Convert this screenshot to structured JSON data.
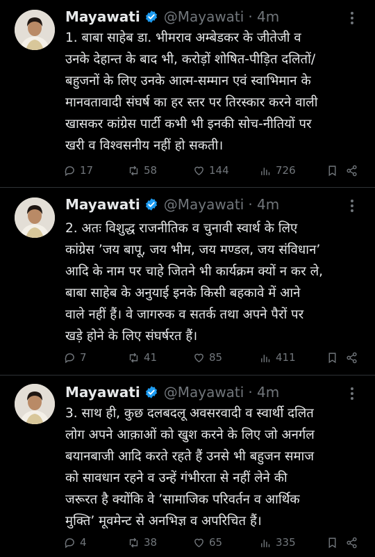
{
  "tweets": [
    {
      "name": "Mayawati",
      "handle": "@Mayawati",
      "time": "· 4m",
      "lines": [
        "1. बाबा साहेब डा. भीमराव अम्बेडकर के जीतेजी व",
        "उनके देहान्त के बाद भी, करोड़ों शोषित-पीड़ित दलितों/",
        "बहुजनों के लिए उनके आत्म-सम्मान एवं स्वाभिमान के",
        "मानवतावादी संघर्ष का हर स्तर पर तिरस्कार करने वाली",
        "खासकर कांग्रेस पार्टी कभी भी इनकी सोच-नीतियों पर",
        "खरी व विश्वसनीय नहीं हो सकती।"
      ],
      "replies": "17",
      "retweets": "58",
      "likes": "144",
      "views": "726"
    },
    {
      "name": "Mayawati",
      "handle": "@Mayawati",
      "time": "· 4m",
      "lines": [
        "2. अतः विशुद्ध राजनीतिक व चुनावी स्वार्थ के लिए",
        "कांग्रेस ’जय बापू, जय भीम, जय मण्डल, जय संविधान’",
        "आदि के नाम पर चाहे जितने भी कार्यक्रम क्यों न कर ले,",
        "बाबा साहेब के अनुयाई इनके किसी बहकावे में आने",
        "वाले नहीं हैं। वे जागरुक व सतर्क तथा अपने पैरों पर",
        "खड़े होने के लिए संघर्षरत हैं।"
      ],
      "replies": "7",
      "retweets": "41",
      "likes": "85",
      "views": "411"
    },
    {
      "name": "Mayawati",
      "handle": "@Mayawati",
      "time": "· 4m",
      "lines": [
        "3. साथ ही, कुछ दलबदलू अवसरवादी व स्वार्थी दलित",
        "लोग अपने आक़ाओं को खुश करने के लिए जो अनर्गल",
        "बयानबाजी आदि करते रहते हैं उनसे भी बहुजन समाज",
        "को सावधान रहने व उन्हें गंभीरता से नहीं लेने की",
        "जरूरत है क्योंकि वे ’सामाजिक परिवर्तन व आर्थिक",
        "मुक्ति’ मूवमेन्ट से अनभिज्ञ व अपरिचित हैं।"
      ],
      "replies": "4",
      "retweets": "38",
      "likes": "65",
      "views": "335"
    }
  ],
  "colors": {
    "background": "#000000",
    "text": "#e7e9ea",
    "muted": "#71767b",
    "verified": "#1d9bf0",
    "divider": "#2f3336"
  }
}
